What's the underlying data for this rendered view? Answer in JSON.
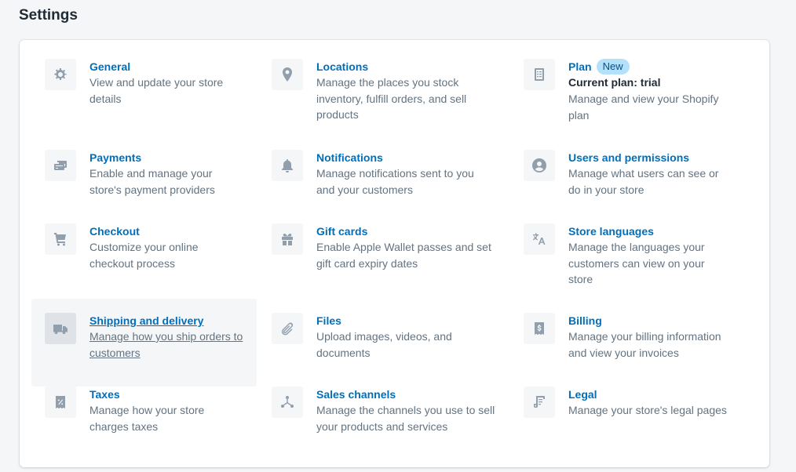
{
  "page": {
    "title": "Settings"
  },
  "items": [
    {
      "title": "General",
      "desc": "View and update your store details",
      "icon": "gear-icon"
    },
    {
      "title": "Locations",
      "desc": "Manage the places you stock inventory, fulfill orders, and sell products",
      "icon": "location-pin-icon"
    },
    {
      "title": "Plan",
      "badge": "New",
      "subtitle": "Current plan: trial",
      "desc": "Manage and view your Shopify plan",
      "icon": "plan-checklist-icon"
    },
    {
      "title": "Payments",
      "desc": "Enable and manage your store's payment providers",
      "icon": "payments-icon"
    },
    {
      "title": "Notifications",
      "desc": "Manage notifications sent to you and your customers",
      "icon": "bell-icon"
    },
    {
      "title": "Users and permissions",
      "desc": "Manage what users can see or do in your store",
      "icon": "user-icon"
    },
    {
      "title": "Checkout",
      "desc": "Customize your online checkout process",
      "icon": "cart-icon"
    },
    {
      "title": "Gift cards",
      "desc": "Enable Apple Wallet passes and set gift card expiry dates",
      "icon": "gift-icon"
    },
    {
      "title": "Store languages",
      "desc": "Manage the languages your customers can view on your store",
      "icon": "translate-icon"
    },
    {
      "title": "Shipping and delivery",
      "desc": "Manage how you ship orders to customers",
      "icon": "truck-icon"
    },
    {
      "title": "Files",
      "desc": "Upload images, videos, and documents",
      "icon": "paperclip-icon"
    },
    {
      "title": "Billing",
      "desc": "Manage your billing information and view your invoices",
      "icon": "billing-receipt-icon"
    },
    {
      "title": "Taxes",
      "desc": "Manage how your store charges taxes",
      "icon": "tax-receipt-icon"
    },
    {
      "title": "Sales channels",
      "desc": "Manage the channels you use to sell your products and services",
      "icon": "channels-icon"
    },
    {
      "title": "Legal",
      "desc": "Manage your store's legal pages",
      "icon": "legal-document-icon"
    }
  ],
  "colors": {
    "link": "#006fbb",
    "muted": "#637381",
    "icon": "#919eab",
    "badge_bg": "#b4e1fa"
  }
}
